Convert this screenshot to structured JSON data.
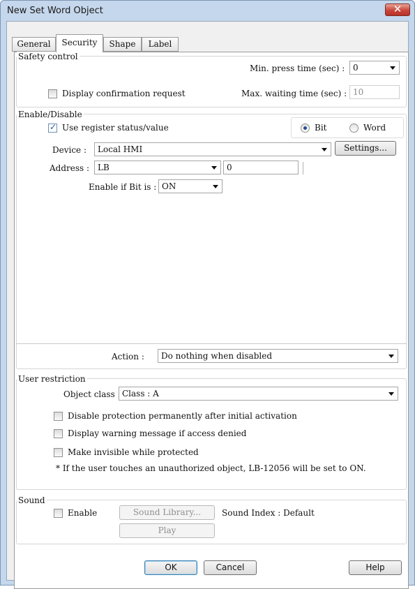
{
  "window": {
    "title": "New Set Word Object",
    "close_glyph": "✕"
  },
  "tabs": [
    {
      "label": "General"
    },
    {
      "label": "Security"
    },
    {
      "label": "Shape"
    },
    {
      "label": "Label"
    }
  ],
  "active_tab": "Security",
  "safety_control": {
    "legend": "Safety control",
    "min_press_label": "Min. press time (sec) :",
    "min_press_value": "0",
    "confirm_label": "Display confirmation request",
    "confirm_checked": false,
    "max_wait_label": "Max. waiting time (sec) :",
    "max_wait_value": "10"
  },
  "enable_disable": {
    "legend": "Enable/Disable",
    "use_register_label": "Use register status/value",
    "use_register_checked": true,
    "bit_label": "Bit",
    "word_label": "Word",
    "selected_mode": "Bit",
    "device_label": "Device :",
    "device_value": "Local HMI",
    "settings_button": "Settings...",
    "address_label": "Address :",
    "address_type": "LB",
    "address_value": "0",
    "enable_if_label": "Enable if Bit is :",
    "enable_if_value": "ON",
    "action_label": "Action :",
    "action_value": "Do nothing when disabled"
  },
  "user_restriction": {
    "legend": "User restriction",
    "object_class_label": "Object class :",
    "object_class_value": "Class : A",
    "options": [
      {
        "label": "Disable protection permanently after initial activation",
        "checked": false
      },
      {
        "label": "Display warning message if access denied",
        "checked": false
      },
      {
        "label": "Make invisible while protected",
        "checked": false
      }
    ],
    "note": "* If the user touches an unauthorized object, LB-12056 will be set to ON."
  },
  "sound": {
    "legend": "Sound",
    "enable_label": "Enable",
    "enable_checked": false,
    "library_button": "Sound Library...",
    "index_text": "Sound Index : Default",
    "play_button": "Play"
  },
  "footer": {
    "ok": "OK",
    "cancel": "Cancel",
    "help": "Help"
  },
  "colors": {
    "title_bar": "#c5d7ec",
    "close_button": "#c9463c",
    "checkbox_tick": "#2d57a3"
  }
}
